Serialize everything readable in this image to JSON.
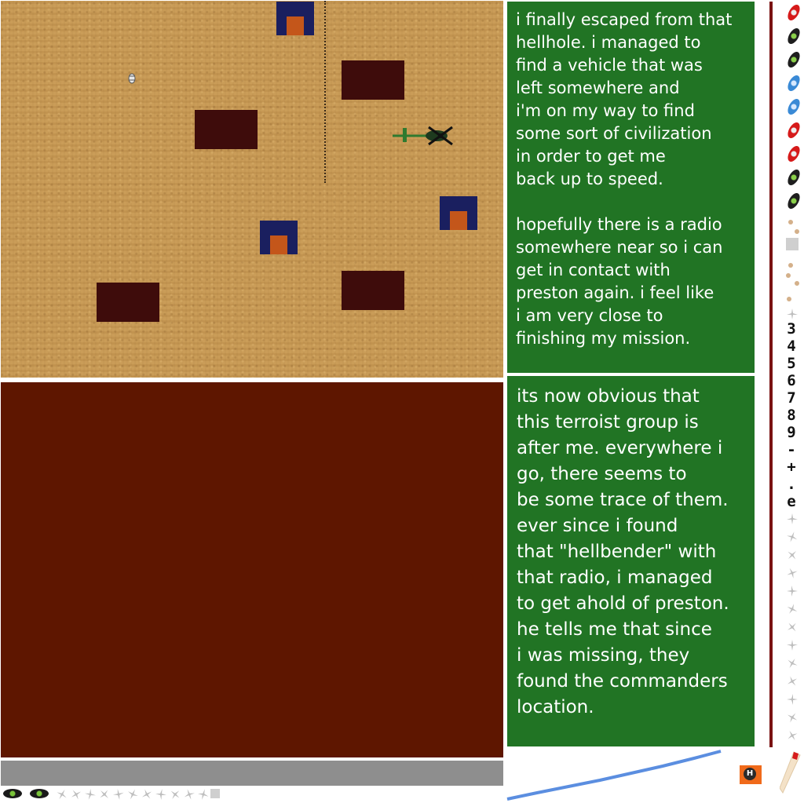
{
  "story": {
    "entry_1": "i finally escaped from that\nhellhole. i managed to\nfind a vehicle that was\nleft somewhere and\ni'm on my way to find\nsome sort of civilization\nin order to get me\nback up to speed.\n\nhopefully there is a radio\nsomewhere near so i can\nget in contact with\npreston again. i feel like\ni am very close to\nfinishing my mission.",
    "entry_2": "its now obvious that\nthis terroist group is\nafter me. everywhere i\ngo, there seems to\nbe some trace of them.\never since i found\nthat \"hellbender\" with\nthat radio, i managed\nto get ahold of preston.\nhe tells me that since\ni was missing, they\nfound the commanders\nlocation."
  },
  "sidebar": {
    "digits": [
      "3",
      "4",
      "5",
      "6",
      "7",
      "8",
      "9",
      "-",
      "+",
      ".",
      "e"
    ]
  },
  "badge": {
    "label": "H"
  },
  "colors": {
    "desert": "#c79a55",
    "building": "#3e0c0b",
    "house_roof": "#1a1f5f",
    "house_door": "#c4561a",
    "panel": "#5e1600",
    "story_bg": "#217424",
    "gauge_line": "#5b8ee0",
    "accent_red": "#d61a1a"
  },
  "icons": [
    "helicopter-icon",
    "soldier-icon",
    "pod-icon",
    "plane-icon",
    "h-badge-icon",
    "pennant-icon"
  ]
}
